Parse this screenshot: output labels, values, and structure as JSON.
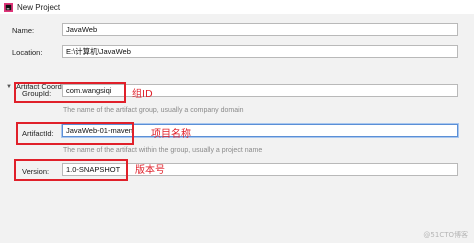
{
  "window": {
    "title": "New Project"
  },
  "form": {
    "name_label": "Name:",
    "name_value": "JavaWeb",
    "location_label": "Location:",
    "location_value": "E:\\计算机\\JavaWeb",
    "section_title": "Artifact Coordinates",
    "groupid_label": "GroupId:",
    "groupid_value": "com.wangsiqi",
    "groupid_hint": "The name of the artifact group, usually a company domain",
    "artifactid_label": "ArtifactId:",
    "artifactid_value": "JavaWeb-01-maven",
    "artifactid_hint": "The name of the artifact within the group, usually a project name",
    "version_label": "Version:",
    "version_value": "1.0-SNAPSHOT"
  },
  "annotations": {
    "groupid_note": "组ID",
    "artifactid_note": "项目名称",
    "version_note": "版本号",
    "color": "#e0202a"
  },
  "watermark": "@51CTO博客"
}
